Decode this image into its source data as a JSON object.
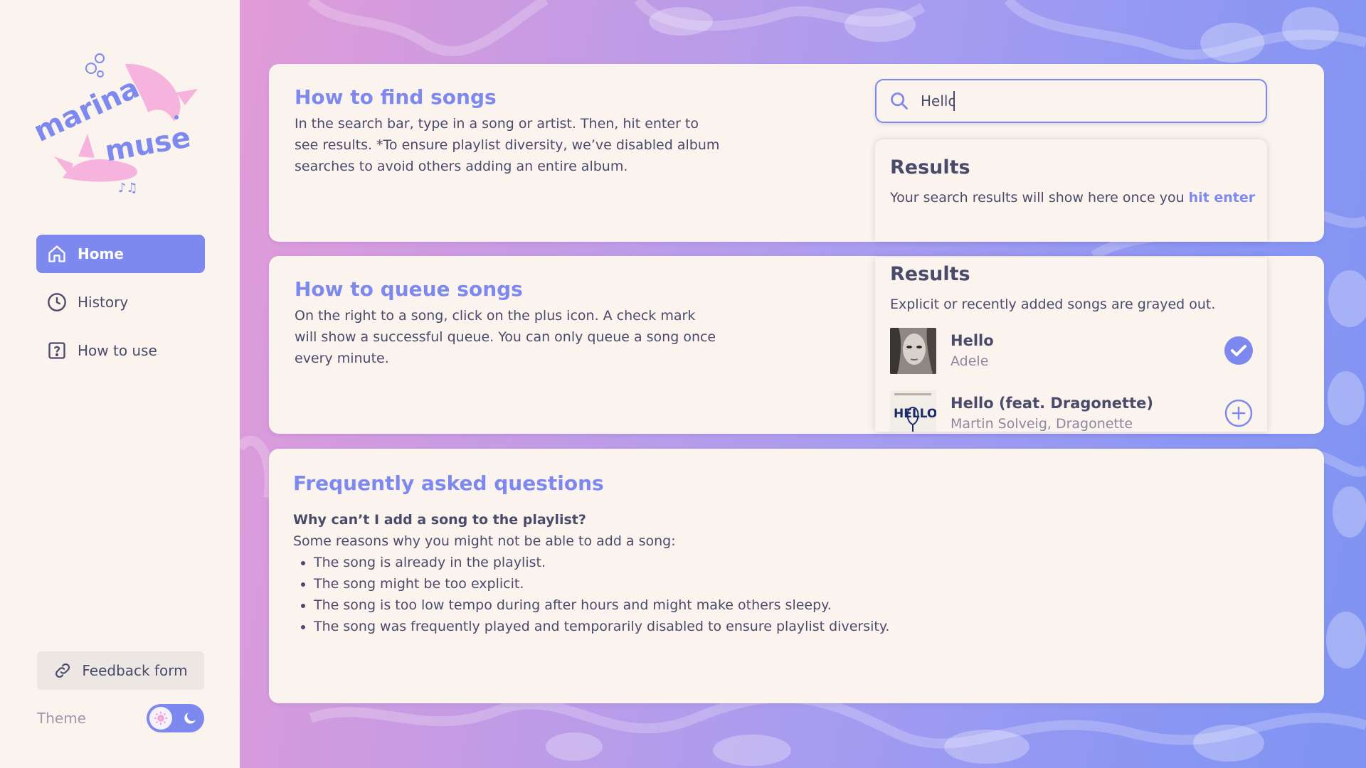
{
  "brand": {
    "logo_text": [
      "marina",
      "muse"
    ]
  },
  "sidebar": {
    "items": [
      {
        "label": "Home",
        "icon": "home-icon",
        "active": true
      },
      {
        "label": "History",
        "icon": "clock-icon",
        "active": false
      },
      {
        "label": "How to use",
        "icon": "question-box-icon",
        "active": false
      }
    ],
    "feedback_label": "Feedback form",
    "theme_label": "Theme"
  },
  "find": {
    "title": "How to find songs",
    "body": "In the search bar, type in a song or artist. Then, hit enter to see results. *To ensure playlist diversity, we’ve disabled album searches to avoid others adding an entire album."
  },
  "search": {
    "value": "Hello",
    "results_title": "Results",
    "results_hint_prefix": "Your search results will show here once you ",
    "results_hint_link": "hit enter"
  },
  "queue": {
    "title": "How to queue songs",
    "body": "On the right to a song, click on the plus icon. A check mark will show a successful queue. You can only queue a song once every minute.",
    "results_title": "Results",
    "results_sub": "Explicit or recently added songs are grayed out.",
    "songs": [
      {
        "title": "Hello",
        "artist": "Adele",
        "state": "queued"
      },
      {
        "title": "Hello (feat. Dragonette)",
        "artist": "Martin Solveig, Dragonette",
        "state": "add"
      }
    ]
  },
  "faq": {
    "title": "Frequently asked questions",
    "question": "Why can’t I add a song to the playlist?",
    "intro": "Some reasons why you might not be able to add a song:",
    "reasons": [
      "The song is already in the playlist.",
      "The song might be too explicit.",
      "The song is too low tempo during after hours and might make others sleepy.",
      "The song was frequently played and temporarily disabled to ensure playlist diversity."
    ]
  },
  "colors": {
    "accent": "#7d89ee",
    "panel": "#fbf4ee",
    "text": "#4a4a6a",
    "logo_pink": "#f6b3de"
  }
}
